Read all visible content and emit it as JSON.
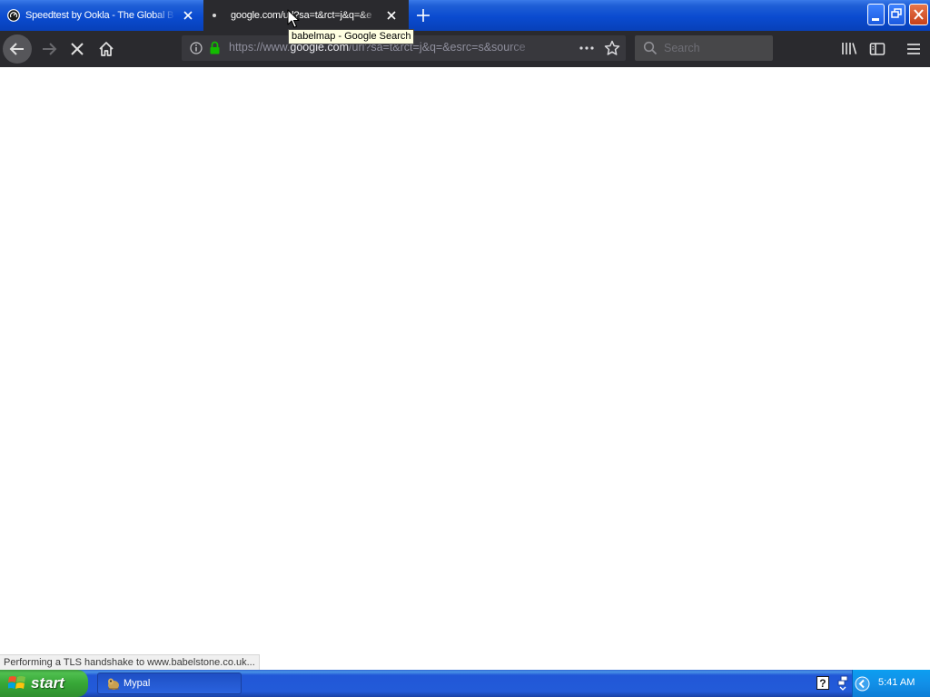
{
  "browser": {
    "tabs": [
      {
        "title": "Speedtest by Ookla - The Global B",
        "icon": "speedometer-icon",
        "active": false
      },
      {
        "title": "google.com/url?sa=t&rct=j&q=&e",
        "icon": "loading-dot-icon",
        "active": true
      }
    ],
    "tooltip": "babelmap - Google Search",
    "url": {
      "prefix": "https://www.",
      "host": "google.com",
      "path": "/url?sa=t&rct=j&q=&esrc=s&source"
    },
    "search_placeholder": "Search",
    "status_text": "Performing a TLS handshake to www.babelstone.co.uk..."
  },
  "taskbar": {
    "start_label": "start",
    "tasks": [
      {
        "label": "Mypal",
        "icon": "mypal-app-icon"
      }
    ],
    "clock": "5:41 AM"
  },
  "colors": {
    "toolbar": "#2a2a2e",
    "url_bar": "#38383d",
    "taskbar_blue": "#235bd8",
    "start_green": "#37a737",
    "lock_green": "#12bc00"
  }
}
